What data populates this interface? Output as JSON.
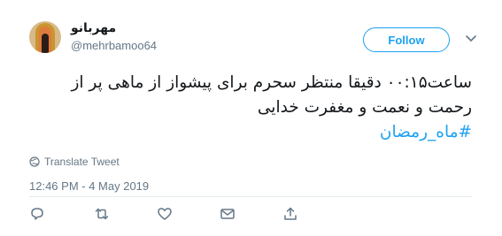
{
  "user": {
    "display_name": "مهربانو",
    "screen_name": "@mehrbamoo64",
    "avatar_icon": "avatar-image"
  },
  "follow_button": {
    "label": "Follow"
  },
  "menu": {
    "icon": "chevron-down-icon"
  },
  "tweet": {
    "line1": "ساعت۰۰:۱۵ دقیقا منتظر سحرم برای پیشواز از ماهی پر از",
    "line2": "رحمت و نعمت و مغفرت خدایی",
    "hashtag": "#ماه_رمضان"
  },
  "translate": {
    "label": "Translate Tweet",
    "icon": "globe-icon"
  },
  "timestamp": "12:46 PM - 4 May 2019",
  "actions": [
    {
      "name": "reply",
      "icon": "reply-icon"
    },
    {
      "name": "retweet",
      "icon": "retweet-icon"
    },
    {
      "name": "like",
      "icon": "heart-icon"
    },
    {
      "name": "message",
      "icon": "mail-icon"
    },
    {
      "name": "share",
      "icon": "share-icon"
    }
  ],
  "colors": {
    "accent": "#1da1f2",
    "muted": "#657786",
    "text": "#14171a",
    "divider": "#e6ecf0"
  }
}
